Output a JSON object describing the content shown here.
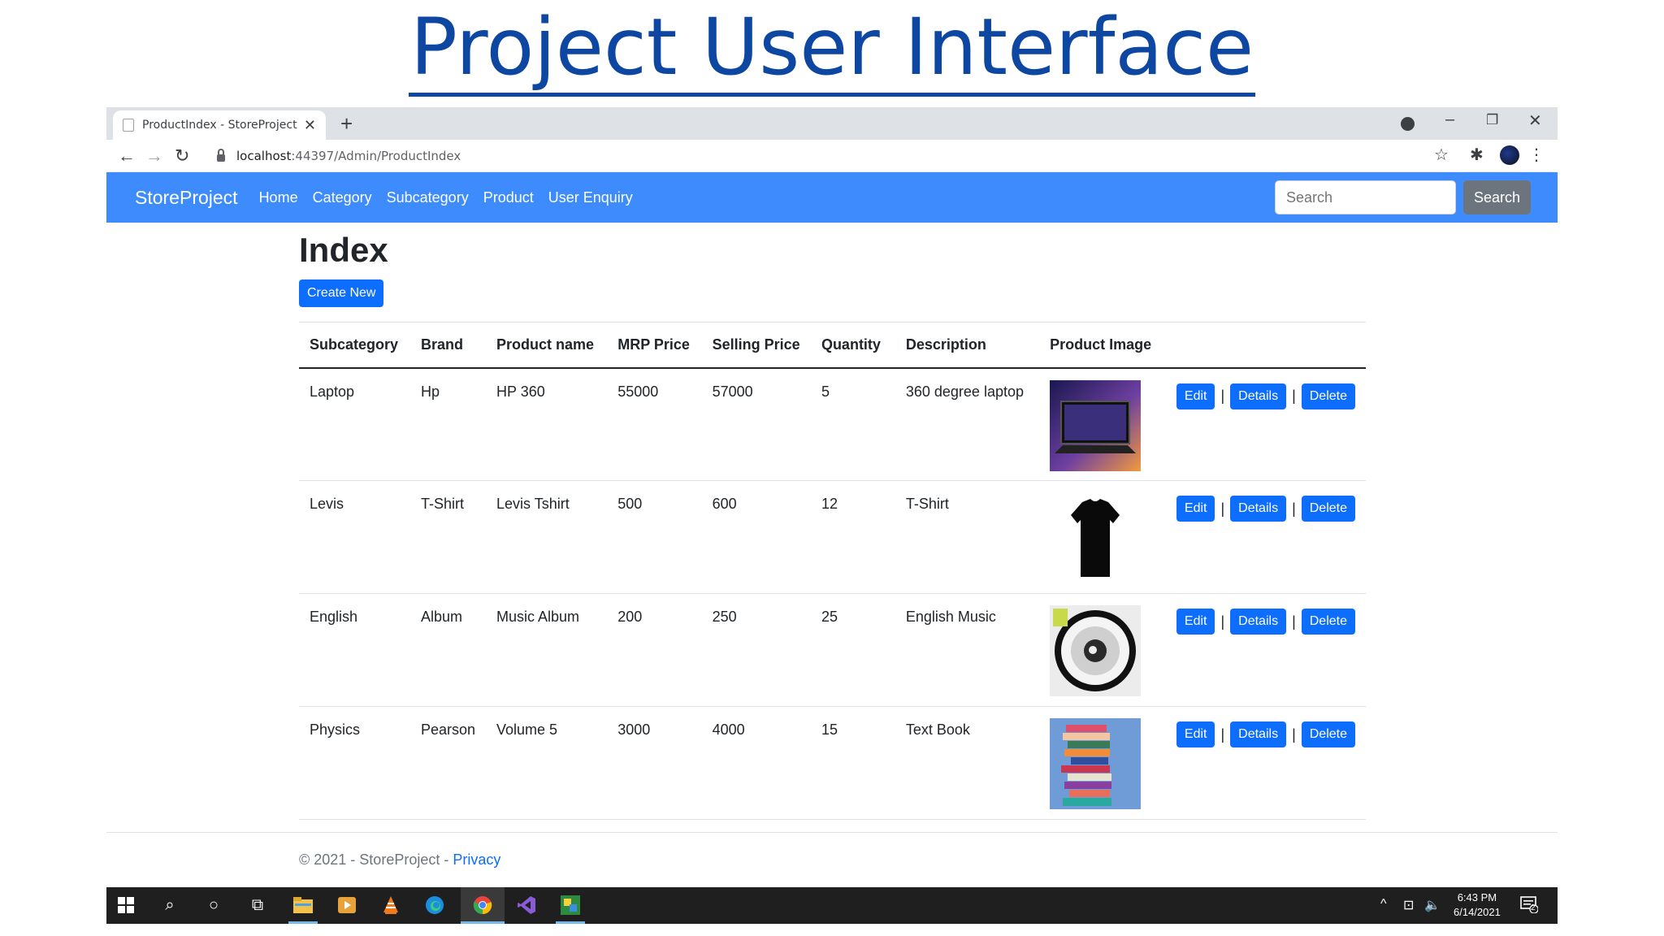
{
  "slide": {
    "title": "Project User Interface"
  },
  "browser": {
    "tab_title": "ProductIndex - StoreProject",
    "url_host": "localhost",
    "url_path": ":44397/Admin/ProductIndex"
  },
  "navbar": {
    "brand": "StoreProject",
    "links": [
      "Home",
      "Category",
      "Subcategory",
      "Product",
      "User Enquiry"
    ],
    "search_placeholder": "Search",
    "search_button": "Search"
  },
  "page": {
    "title": "Index",
    "create_button": "Create New",
    "columns": [
      "Subcategory",
      "Brand",
      "Product name",
      "MRP Price",
      "Selling Price",
      "Quantity",
      "Description",
      "Product Image"
    ],
    "actions": {
      "edit": "Edit",
      "details": "Details",
      "delete": "Delete",
      "separator": "|"
    },
    "rows": [
      {
        "subcategory": "Laptop",
        "brand": "Hp",
        "product_name": "HP 360",
        "mrp": "55000",
        "selling": "57000",
        "quantity": "5",
        "description": "360 degree laptop",
        "image": "laptop-image"
      },
      {
        "subcategory": "Levis",
        "brand": "T-Shirt",
        "product_name": "Levis Tshirt",
        "mrp": "500",
        "selling": "600",
        "quantity": "12",
        "description": "T-Shirt",
        "image": "tshirt-image"
      },
      {
        "subcategory": "English",
        "brand": "Album",
        "product_name": "Music Album",
        "mrp": "200",
        "selling": "250",
        "quantity": "25",
        "description": "English Music",
        "image": "album-image"
      },
      {
        "subcategory": "Physics",
        "brand": "Pearson",
        "product_name": "Volume 5",
        "mrp": "3000",
        "selling": "4000",
        "quantity": "15",
        "description": "Text Book",
        "image": "books-image"
      }
    ]
  },
  "footer": {
    "text": "© 2021 - StoreProject - ",
    "link": "Privacy"
  },
  "taskbar": {
    "time": "6:43 PM",
    "date": "6/14/2021",
    "notification_count": "2"
  },
  "colors": {
    "navbar": "#3d8bfd",
    "primary_button": "#0d6efd",
    "secondary_button": "#6c757d",
    "title_blue": "#0d47a1"
  }
}
